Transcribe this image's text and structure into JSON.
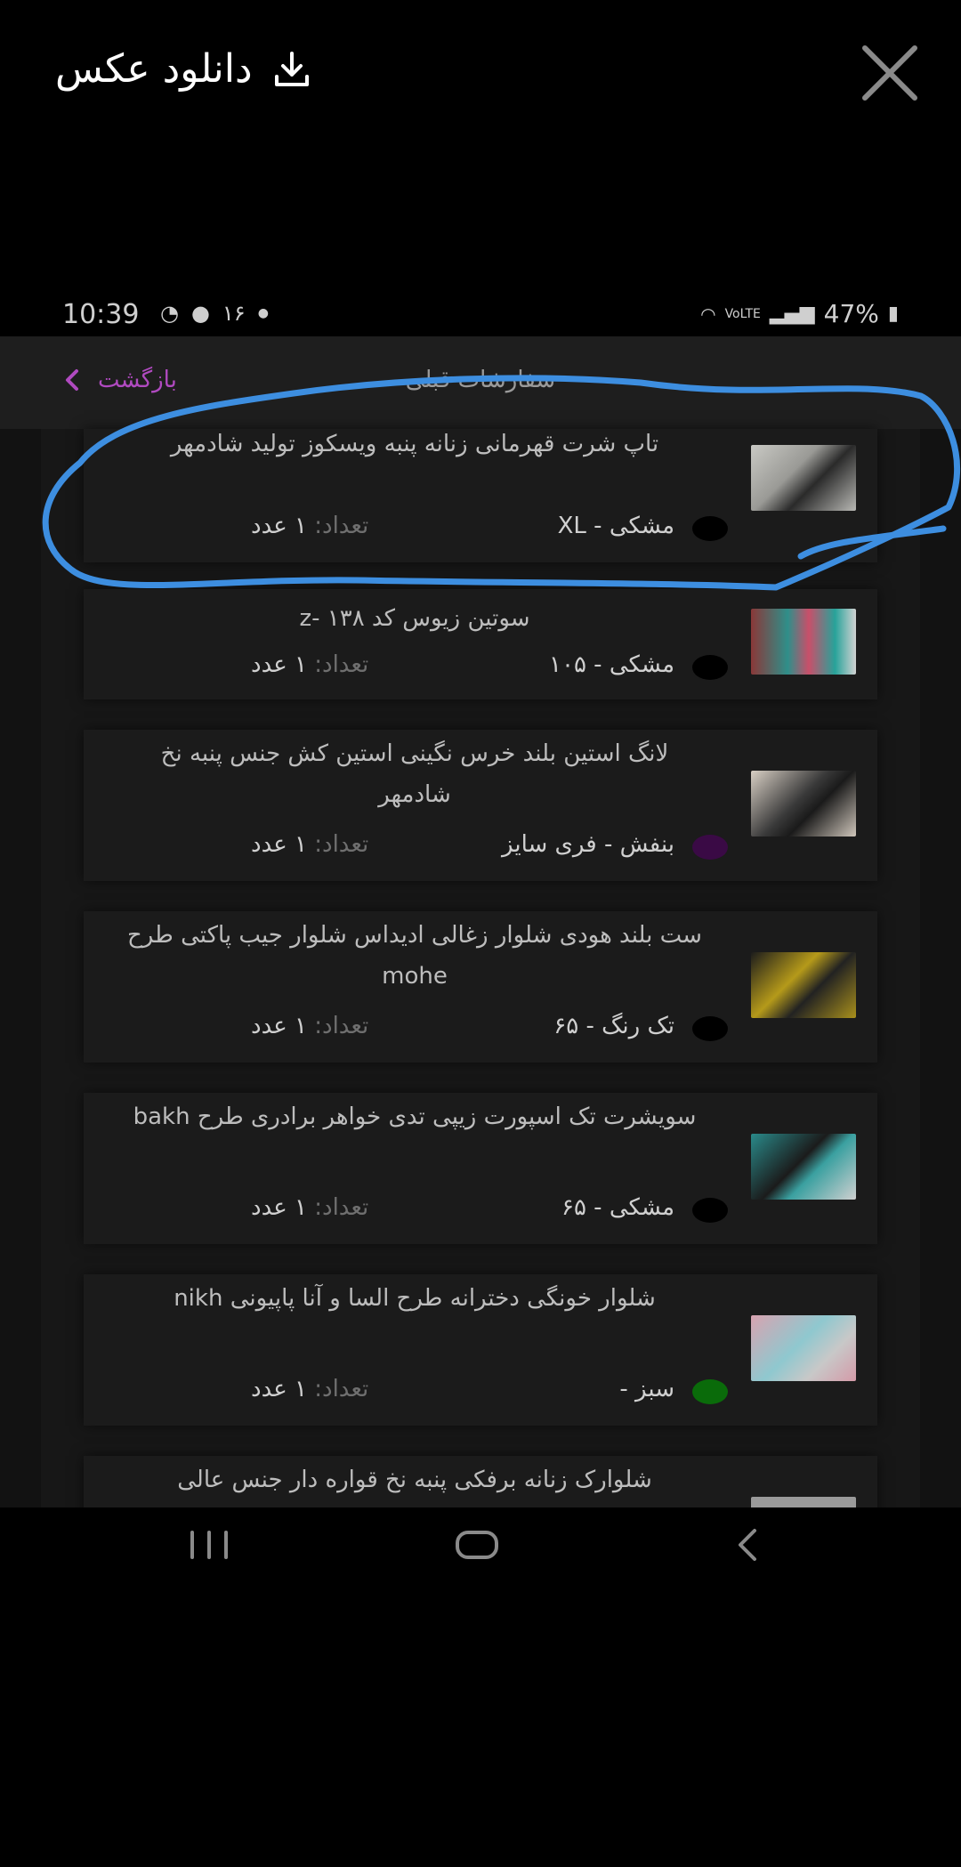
{
  "viewer": {
    "download_label": "دانلود عکس",
    "download_icon": "download-icon",
    "close_icon": "close-icon"
  },
  "statusbar": {
    "time": "10:39",
    "notif_count": "۱۶",
    "battery": "47%"
  },
  "appbar": {
    "back_label": "بازگشت",
    "title": "سفارشات قبلی"
  },
  "orders": [
    {
      "title": "تاپ شرت قهرمانی زنانه پنبه ویسکوز تولید شادمهر",
      "color_name": "مشکی",
      "size": "XL",
      "qty_label": "تعداد:",
      "qty_value": "۱ عدد",
      "dot_color": "#000000"
    },
    {
      "title": "سوتین زیوس کد ۱۳۸ -z",
      "color_name": "مشکی",
      "size": "۱۰۵",
      "qty_label": "تعداد:",
      "qty_value": "۱ عدد",
      "dot_color": "#000000"
    },
    {
      "title": "لانگ استین بلند خرس نگینی استین کش جنس پنبه نخ شادمهر",
      "color_name": "بنفش",
      "size": "فری سایز",
      "qty_label": "تعداد:",
      "qty_value": "۱ عدد",
      "dot_color": "#3a0a45"
    },
    {
      "title": "ست بلند هودی شلوار زغالی ادیداس شلوار جیب پاکتی طرح mohe",
      "color_name": "تک رنگ",
      "size": "۶۵",
      "qty_label": "تعداد:",
      "qty_value": "۱ عدد",
      "dot_color": "#000000"
    },
    {
      "title": "سویشرت تک اسپورت زیپی تدی خواهر برادری طرح bakh",
      "color_name": "مشکی",
      "size": "۶۵",
      "qty_label": "تعداد:",
      "qty_value": "۱ عدد",
      "dot_color": "#000000"
    },
    {
      "title": "شلوار خونگی دخترانه طرح السا و آنا پاپیونی nikh",
      "color_name": "سبز",
      "size": "",
      "qty_label": "تعداد:",
      "qty_value": "۱ عدد",
      "dot_color": "#0a6b0a"
    },
    {
      "title": "شلوارک زنانه برفکی پنبه نخ قواره دار جنس عالی",
      "color_name": "",
      "size": "",
      "qty_label": "",
      "qty_value": "",
      "dot_color": ""
    }
  ],
  "navbar": {
    "recents_icon": "recents-icon",
    "home_icon": "home-icon",
    "back_icon": "back-icon"
  },
  "colors": {
    "accent": "#b04ac0",
    "annotation": "#3d8ee0"
  }
}
